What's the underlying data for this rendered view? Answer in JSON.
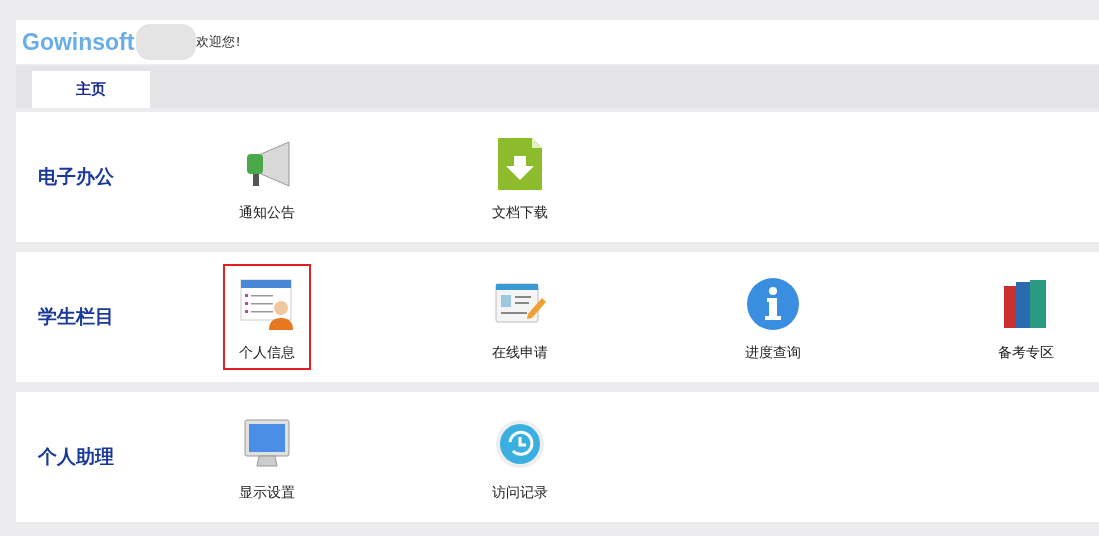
{
  "header": {
    "logo": "Gowinsoft",
    "welcome": "欢迎您!"
  },
  "tabs": [
    {
      "label": "主页",
      "selected": true
    }
  ],
  "sections": [
    {
      "title": "电子办公",
      "items": [
        {
          "label": "通知公告",
          "kind": "megaphone",
          "highlighted": false
        },
        {
          "label": "文档下载",
          "kind": "download",
          "highlighted": false
        }
      ]
    },
    {
      "title": "学生栏目",
      "items": [
        {
          "label": "个人信息",
          "kind": "profile",
          "highlighted": true
        },
        {
          "label": "在线申请",
          "kind": "form",
          "highlighted": false
        },
        {
          "label": "进度查询",
          "kind": "info",
          "highlighted": false
        },
        {
          "label": "备考专区",
          "kind": "books",
          "highlighted": false
        }
      ]
    },
    {
      "title": "个人助理",
      "items": [
        {
          "label": "显示设置",
          "kind": "monitor",
          "highlighted": false
        },
        {
          "label": "访问记录",
          "kind": "history",
          "highlighted": false
        }
      ]
    }
  ]
}
